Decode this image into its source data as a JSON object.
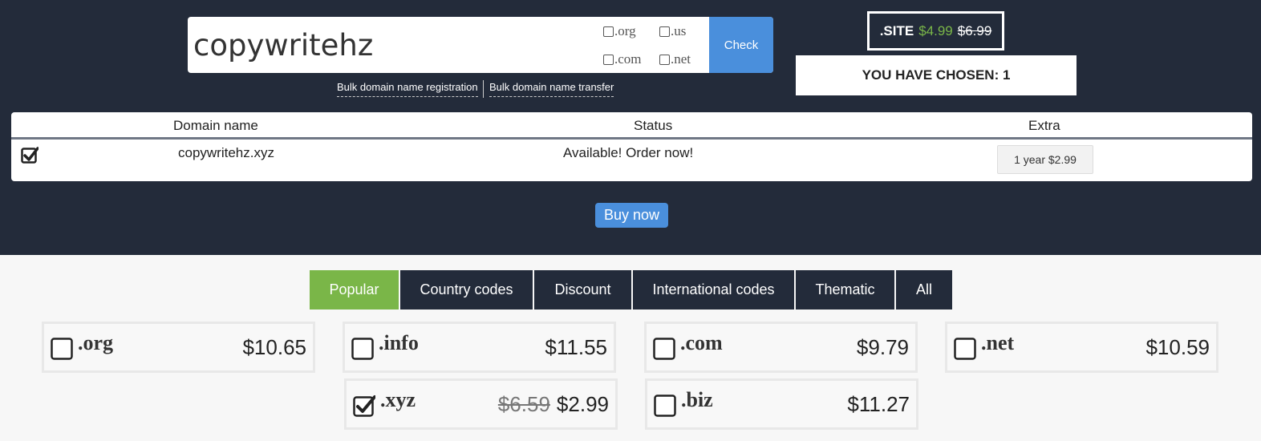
{
  "search": {
    "value": "copywritehz",
    "options": [
      {
        "label": ".org",
        "checked": false
      },
      {
        "label": ".us",
        "checked": false
      },
      {
        "label": ".com",
        "checked": false
      },
      {
        "label": ".net",
        "checked": false
      }
    ],
    "check_label": "Check"
  },
  "bulk": {
    "registration": "Bulk domain name registration",
    "transfer": "Bulk domain name transfer"
  },
  "promo": {
    "ext": ".SITE",
    "price": "$4.99",
    "old_price": "$6.99"
  },
  "chosen": "YOU HAVE CHOSEN: 1",
  "results": {
    "headers": [
      "Domain name",
      "Status",
      "Extra"
    ],
    "rows": [
      {
        "checked": true,
        "domain": "copywritehz.xyz",
        "status": "Available! Order now!",
        "extra": "1 year $2.99"
      }
    ]
  },
  "buy_label": "Buy now",
  "tabs": [
    {
      "label": "Popular",
      "active": true
    },
    {
      "label": "Country codes",
      "active": false
    },
    {
      "label": "Discount",
      "active": false
    },
    {
      "label": "International codes",
      "active": false
    },
    {
      "label": "Thematic",
      "active": false
    },
    {
      "label": "All",
      "active": false
    }
  ],
  "tlds": [
    {
      "name": ".org",
      "price": "$10.65",
      "checked": false
    },
    {
      "name": ".info",
      "price": "$11.55",
      "checked": false
    },
    {
      "name": ".com",
      "price": "$9.79",
      "checked": false
    },
    {
      "name": ".net",
      "price": "$10.59",
      "checked": false
    },
    {
      "name": ".xyz",
      "old_price": "$6.59",
      "price": "$2.99",
      "checked": true
    },
    {
      "name": ".biz",
      "price": "$11.27",
      "checked": false
    }
  ],
  "colors": {
    "header_bg": "#232b3a",
    "accent_blue": "#4a8fdc",
    "accent_green": "#7ab648"
  }
}
